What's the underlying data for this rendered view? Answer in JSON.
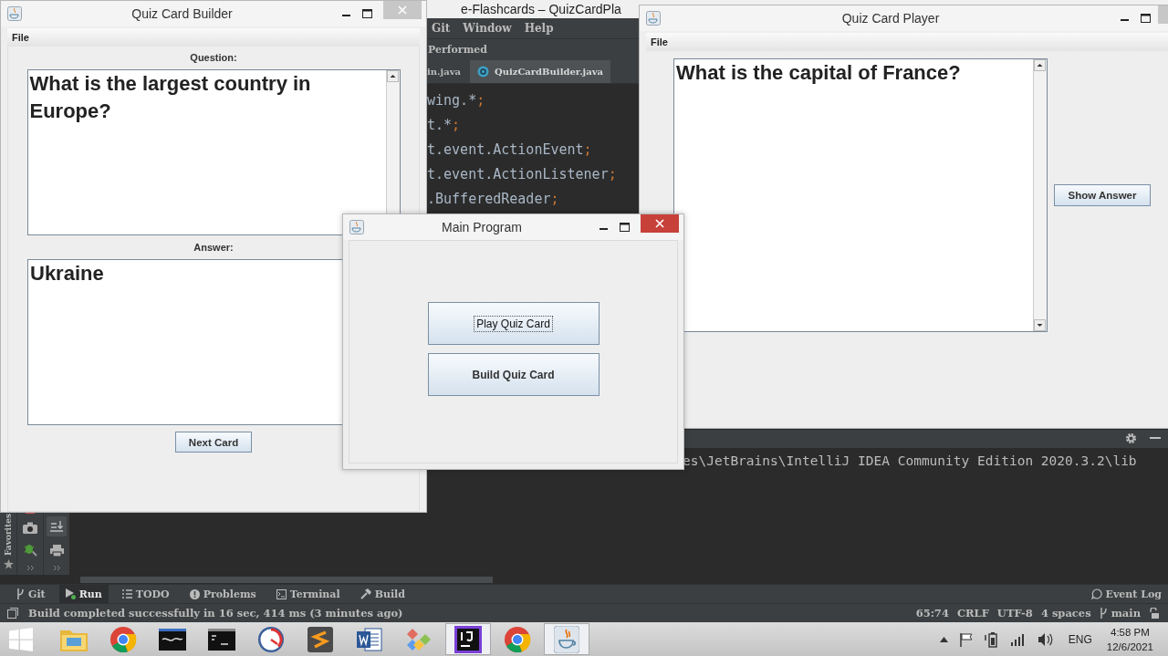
{
  "ide": {
    "title": "e-Flashcards – QuizCardPla",
    "menu": [
      "Git",
      "Window",
      "Help"
    ],
    "breadcrumb": "Performed",
    "tabs": [
      {
        "label": "in.java",
        "selected": false
      },
      {
        "label": "QuizCardBuilder.java",
        "selected": true
      }
    ],
    "code_lines": [
      "wing.*;",
      "t.*;",
      "t.event.ActionEvent;",
      "t.event.ActionListener;",
      ".BufferedReader;"
    ],
    "favorites_label": "Favorites",
    "console_line": "es\\JetBrains\\IntelliJ IDEA Community Edition 2020.3.2\\lib",
    "tool_tabs": [
      {
        "kind": "git",
        "label": "Git",
        "selected": false
      },
      {
        "kind": "run",
        "label": "Run",
        "selected": true
      },
      {
        "kind": "todo",
        "label": "TODO",
        "selected": false
      },
      {
        "kind": "problems",
        "label": "Problems",
        "selected": false
      },
      {
        "kind": "terminal",
        "label": "Terminal",
        "selected": false
      },
      {
        "kind": "build",
        "label": "Build",
        "selected": false
      }
    ],
    "event_log": "Event Log",
    "status_message": "Build completed successfully in 16 sec, 414 ms (3 minutes ago)",
    "status_items": [
      {
        "kind": "text",
        "label": "65:74"
      },
      {
        "kind": "text",
        "label": "CRLF"
      },
      {
        "kind": "text",
        "label": "UTF-8"
      },
      {
        "kind": "text",
        "label": "4 spaces"
      },
      {
        "kind": "branch",
        "label": "main"
      }
    ]
  },
  "builder_window": {
    "title": "Quiz Card Builder",
    "menu": [
      "File"
    ],
    "question_label": "Question:",
    "question_text": "What is the largest country in Europe?",
    "answer_label": "Answer:",
    "answer_text": "Ukraine",
    "button": "Next Card"
  },
  "player_window": {
    "title": "Quiz Card Player",
    "menu": [
      "File"
    ],
    "question_text": "What is the capital of France?",
    "button": "Show Answer"
  },
  "main_window": {
    "title": "Main Program",
    "buttons": [
      {
        "label": "Play Quiz Card",
        "focused": true
      },
      {
        "label": "Build Quiz Card",
        "focused": false
      }
    ]
  },
  "taskbar": {
    "apps": [
      {
        "kind": "folder",
        "active": false
      },
      {
        "kind": "browser",
        "active": false
      },
      {
        "kind": "database",
        "active": false
      },
      {
        "kind": "console",
        "active": false
      },
      {
        "kind": "gauge",
        "active": false
      },
      {
        "kind": "editor",
        "active": false
      },
      {
        "kind": "word",
        "active": false
      },
      {
        "kind": "diamond",
        "active": false
      },
      {
        "kind": "ide",
        "active": true
      },
      {
        "kind": "browser",
        "active": false
      },
      {
        "kind": "cup",
        "active": true
      }
    ],
    "language": "ENG",
    "time": "4:58 PM",
    "date": "12/6/2021"
  }
}
